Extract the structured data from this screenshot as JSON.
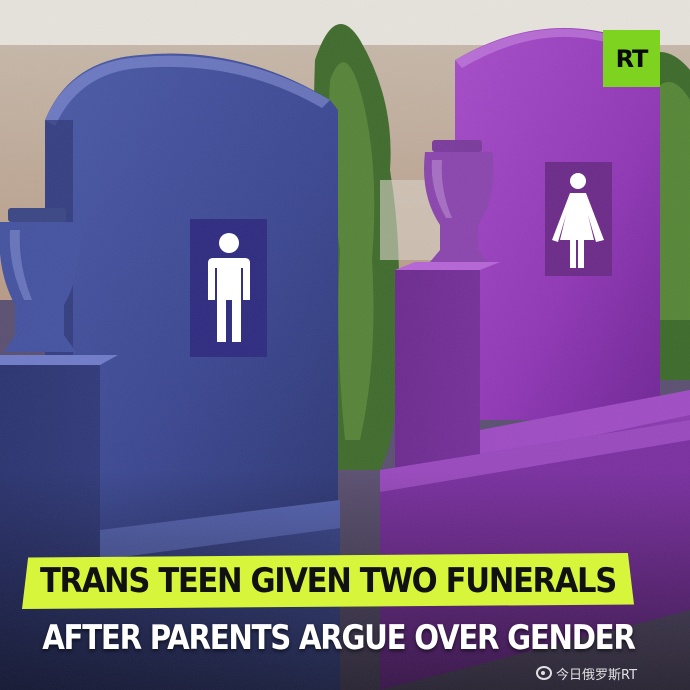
{
  "image": {
    "brand_logo_text": "RT",
    "headline_line1": "TRANS TEEN GIVEN TWO FUNERALS",
    "headline_line2": "AFTER PARENTS ARGUE OVER GENDER",
    "watermark_text": "今日俄罗斯RT"
  },
  "colors": {
    "brand_green": "#7ed321",
    "highlight_yellow": "#d7f53a",
    "headstone_blue": "#3a4a9a",
    "headstone_purple": "#9a3ac2"
  },
  "icons": {
    "male_symbol": "male-restroom-icon",
    "female_symbol": "female-restroom-icon",
    "watermark_logo": "weibo-icon"
  }
}
